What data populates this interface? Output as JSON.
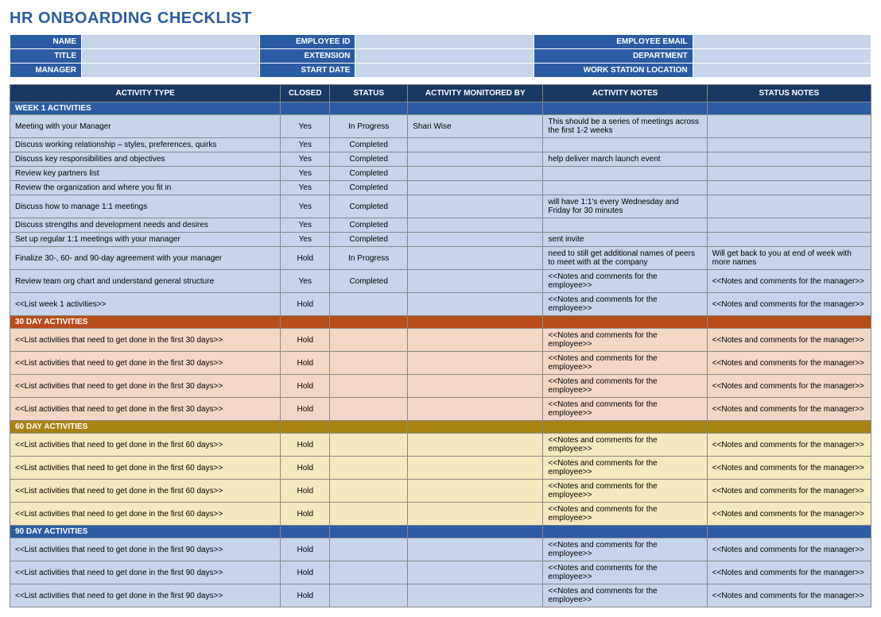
{
  "title": "HR ONBOARDING CHECKLIST",
  "info": {
    "rows": [
      {
        "l1": "NAME",
        "v1": "",
        "l2": "EMPLOYEE ID",
        "v2": "",
        "l3": "EMPLOYEE EMAIL",
        "v3": ""
      },
      {
        "l1": "TITLE",
        "v1": "",
        "l2": "EXTENSION",
        "v2": "",
        "l3": "DEPARTMENT",
        "v3": ""
      },
      {
        "l1": "MANAGER",
        "v1": "",
        "l2": "START DATE",
        "v2": "",
        "l3": "WORK STATION LOCATION",
        "v3": ""
      }
    ]
  },
  "columns": {
    "activity": "ACTIVITY TYPE",
    "closed": "CLOSED",
    "status": "STATUS",
    "monitored": "ACTIVITY MONITORED BY",
    "activity_notes": "ACTIVITY NOTES",
    "status_notes": "STATUS NOTES"
  },
  "sections": [
    {
      "label": "WEEK 1 ACTIVITIES",
      "bg": "#2b5ca3",
      "row_bg": "#c7d4ea",
      "rows": [
        {
          "activity": "Meeting with your Manager",
          "closed": "Yes",
          "status": "In Progress",
          "monitored": "Shari Wise",
          "activity_notes": "This should be a series of meetings across the first 1-2 weeks",
          "status_notes": ""
        },
        {
          "activity": "Discuss working relationship – styles, preferences, quirks",
          "closed": "Yes",
          "status": "Completed",
          "monitored": "",
          "activity_notes": "",
          "status_notes": ""
        },
        {
          "activity": "Discuss key responsibilities and objectives",
          "closed": "Yes",
          "status": "Completed",
          "monitored": "",
          "activity_notes": "help deliver march launch event",
          "status_notes": ""
        },
        {
          "activity": "Review key partners list",
          "closed": "Yes",
          "status": "Completed",
          "monitored": "",
          "activity_notes": "",
          "status_notes": ""
        },
        {
          "activity": "Review the organization and where you fit in",
          "closed": "Yes",
          "status": "Completed",
          "monitored": "",
          "activity_notes": "",
          "status_notes": ""
        },
        {
          "activity": "Discuss how to manage 1:1 meetings",
          "closed": "Yes",
          "status": "Completed",
          "monitored": "",
          "activity_notes": "will have 1:1's every Wednesday and Friday for 30 minutes",
          "status_notes": ""
        },
        {
          "activity": "Discuss strengths and development needs and desires",
          "closed": "Yes",
          "status": "Completed",
          "monitored": "",
          "activity_notes": "",
          "status_notes": ""
        },
        {
          "activity": "Set up regular 1:1 meetings with your manager",
          "closed": "Yes",
          "status": "Completed",
          "monitored": "",
          "activity_notes": "sent invite",
          "status_notes": ""
        },
        {
          "activity": "Finalize 30-, 60- and 90-day agreement with your manager",
          "closed": "Hold",
          "status": "In Progress",
          "monitored": "",
          "activity_notes": "need to still get additional names of peers to meet with at the company",
          "status_notes": "Will get back to you at end of week with more names"
        },
        {
          "activity": "Review team org chart and understand general structure",
          "closed": "Yes",
          "status": "Completed",
          "monitored": "",
          "activity_notes": "<<Notes and comments for the employee>>",
          "status_notes": "<<Notes and comments for the manager>>"
        },
        {
          "activity": "<<List week 1 activities>>",
          "closed": "Hold",
          "status": "",
          "monitored": "",
          "activity_notes": "<<Notes and comments for the employee>>",
          "status_notes": "<<Notes and comments for the manager>>"
        }
      ]
    },
    {
      "label": "30 DAY ACTIVITIES",
      "bg": "#b84d1c",
      "row_bg": "#f1d7c5",
      "rows": [
        {
          "activity": "<<List activities that need to get done in the first 30 days>>",
          "closed": "Hold",
          "status": "",
          "monitored": "",
          "activity_notes": "<<Notes and comments for the employee>>",
          "status_notes": "<<Notes and comments for the manager>>"
        },
        {
          "activity": "<<List activities that need to get done in the first 30 days>>",
          "closed": "Hold",
          "status": "",
          "monitored": "",
          "activity_notes": "<<Notes and comments for the employee>>",
          "status_notes": "<<Notes and comments for the manager>>"
        },
        {
          "activity": "<<List activities that need to get done in the first 30 days>>",
          "closed": "Hold",
          "status": "",
          "monitored": "",
          "activity_notes": "<<Notes and comments for the employee>>",
          "status_notes": "<<Notes and comments for the manager>>"
        },
        {
          "activity": "<<List activities that need to get done in the first 30 days>>",
          "closed": "Hold",
          "status": "",
          "monitored": "",
          "activity_notes": "<<Notes and comments for the employee>>",
          "status_notes": "<<Notes and comments for the manager>>"
        }
      ]
    },
    {
      "label": "60 DAY ACTIVITIES",
      "bg": "#a88414",
      "row_bg": "#f4e8be",
      "rows": [
        {
          "activity": "<<List activities that need to get done in the first 60 days>>",
          "closed": "Hold",
          "status": "",
          "monitored": "",
          "activity_notes": "<<Notes and comments for the employee>>",
          "status_notes": "<<Notes and comments for the manager>>"
        },
        {
          "activity": "<<List activities that need to get done in the first 60 days>>",
          "closed": "Hold",
          "status": "",
          "monitored": "",
          "activity_notes": "<<Notes and comments for the employee>>",
          "status_notes": "<<Notes and comments for the manager>>"
        },
        {
          "activity": "<<List activities that need to get done in the first 60 days>>",
          "closed": "Hold",
          "status": "",
          "monitored": "",
          "activity_notes": "<<Notes and comments for the employee>>",
          "status_notes": "<<Notes and comments for the manager>>"
        },
        {
          "activity": "<<List activities that need to get done in the first 60 days>>",
          "closed": "Hold",
          "status": "",
          "monitored": "",
          "activity_notes": "<<Notes and comments for the employee>>",
          "status_notes": "<<Notes and comments for the manager>>"
        }
      ]
    },
    {
      "label": "90 DAY ACTIVITIES",
      "bg": "#2b5ca3",
      "row_bg": "#c7d4ea",
      "rows": [
        {
          "activity": "<<List activities that need to get done in the first 90 days>>",
          "closed": "Hold",
          "status": "",
          "monitored": "",
          "activity_notes": "<<Notes and comments for the employee>>",
          "status_notes": "<<Notes and comments for the manager>>"
        },
        {
          "activity": "<<List activities that need to get done in the first 90 days>>",
          "closed": "Hold",
          "status": "",
          "monitored": "",
          "activity_notes": "<<Notes and comments for the employee>>",
          "status_notes": "<<Notes and comments for the manager>>"
        },
        {
          "activity": "<<List activities that need to get done in the first 90 days>>",
          "closed": "Hold",
          "status": "",
          "monitored": "",
          "activity_notes": "<<Notes and comments for the employee>>",
          "status_notes": "<<Notes and comments for the manager>>"
        }
      ]
    }
  ]
}
